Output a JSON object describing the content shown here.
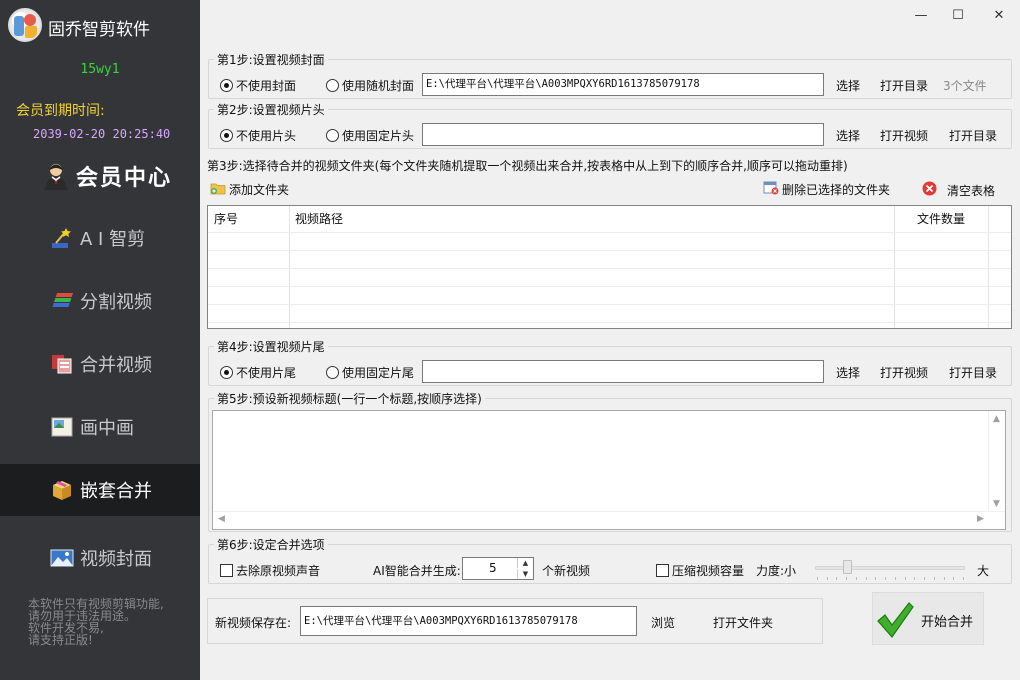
{
  "app": {
    "title": "固乔智剪软件"
  },
  "user": {
    "name": "15wy1",
    "expire_label": "会员到期时间:",
    "expire_date": "2039-02-20 20:25:40"
  },
  "nav": {
    "member": "会员中心",
    "ai": "A I 智剪",
    "split": "分割视频",
    "merge": "合并视频",
    "pip": "画中画",
    "nested": "嵌套合并",
    "cover": "视频封面"
  },
  "disclaimer": [
    "本软件只有视频剪辑功能,",
    "请勿用于违法用途。",
    "软件开发不易,",
    "请支持正版!"
  ],
  "window": {
    "min": "—",
    "max": "☐",
    "close": "✕"
  },
  "step1": {
    "title": "第1步:设置视频封面",
    "opt_none": "不使用封面",
    "opt_random": "使用随机封面",
    "path": "E:\\代理平台\\代理平台\\A003MPQXY6RD1613785079178",
    "select": "选择",
    "open_dir": "打开目录",
    "count": "3个文件"
  },
  "step2": {
    "title": "第2步:设置视频片头",
    "opt_none": "不使用片头",
    "opt_fixed": "使用固定片头",
    "path": "",
    "select": "选择",
    "open_video": "打开视频",
    "open_dir": "打开目录"
  },
  "step3": {
    "title": "第3步:选择待合并的视频文件夹(每个文件夹随机提取一个视频出来合并,按表格中从上到下的顺序合并,顺序可以拖动重排)",
    "add_folder": "添加文件夹",
    "delete_selected": "删除已选择的文件夹",
    "clear_table": "清空表格",
    "columns": [
      "序号",
      "视频路径",
      "文件数量"
    ]
  },
  "step4": {
    "title": "第4步:设置视频片尾",
    "opt_none": "不使用片尾",
    "opt_fixed": "使用固定片尾",
    "path": "",
    "select": "选择",
    "open_video": "打开视频",
    "open_dir": "打开目录"
  },
  "step5": {
    "title": "第5步:预设新视频标题(一行一个标题,按顺序选择)",
    "content": ""
  },
  "step6": {
    "title": "第6步:设定合并选项",
    "remove_audio": "去除原视频声音",
    "ai_gen_label": "AI智能合并生成:",
    "ai_gen_value": "5",
    "ai_gen_unit": "个新视频",
    "compress": "压缩视频容量",
    "strength_label": "力度:小",
    "strength_max": "大",
    "strength_level": 0.2
  },
  "save": {
    "label": "新视频保存在:",
    "path": "E:\\代理平台\\代理平台\\A003MPQXY6RD1613785079178",
    "browse": "浏览",
    "open_folder": "打开文件夹"
  },
  "start": {
    "label": "开始合并"
  },
  "colors": {
    "sidebar": "#333538",
    "active": "#1c1d1f",
    "username": "#37d63c",
    "expire_label": "#f2d22e",
    "expire_date": "#d8a6ff"
  }
}
